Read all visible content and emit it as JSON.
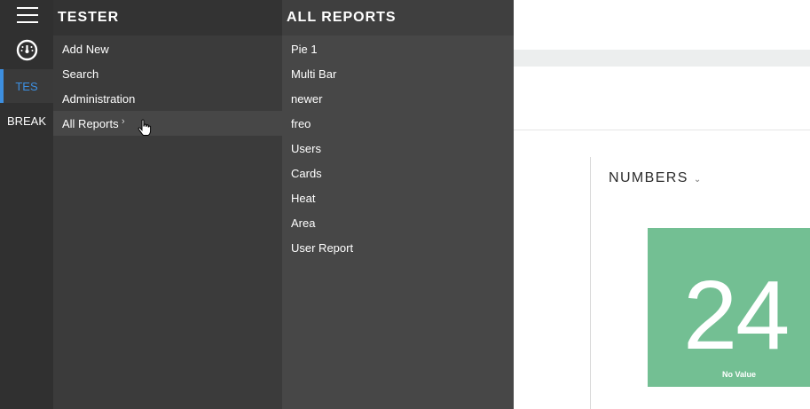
{
  "rail": {
    "menu_icon": "hamburger-icon",
    "dashboard_icon": "dashboard-gauge-icon",
    "items": [
      {
        "label": "TES",
        "active": true
      },
      {
        "label": "BREAK",
        "active": false
      }
    ],
    "accent_color": "#3d8fe0"
  },
  "panel1": {
    "title": "TESTER",
    "items": [
      {
        "label": "Add New"
      },
      {
        "label": "Search"
      },
      {
        "label": "Administration"
      },
      {
        "label": "All Reports",
        "has_submenu": true
      }
    ],
    "submenu_icon": "chevron-right-icon",
    "submenu_arrow": "›"
  },
  "panel2": {
    "title": "ALL REPORTS",
    "items": [
      {
        "label": "Pie 1"
      },
      {
        "label": "Multi Bar"
      },
      {
        "label": "newer"
      },
      {
        "label": "freo"
      },
      {
        "label": "Users"
      },
      {
        "label": "Cards"
      },
      {
        "label": "Heat"
      },
      {
        "label": "Area"
      },
      {
        "label": "User Report"
      }
    ]
  },
  "widget": {
    "title": "NUMBERS",
    "dropdown_icon": "chevron-down-icon",
    "dropdown_glyph": "⌄",
    "value": "24",
    "subtitle": "No Value",
    "card_color": "#73bf93"
  },
  "cursor_icon": "hand-pointer-icon"
}
